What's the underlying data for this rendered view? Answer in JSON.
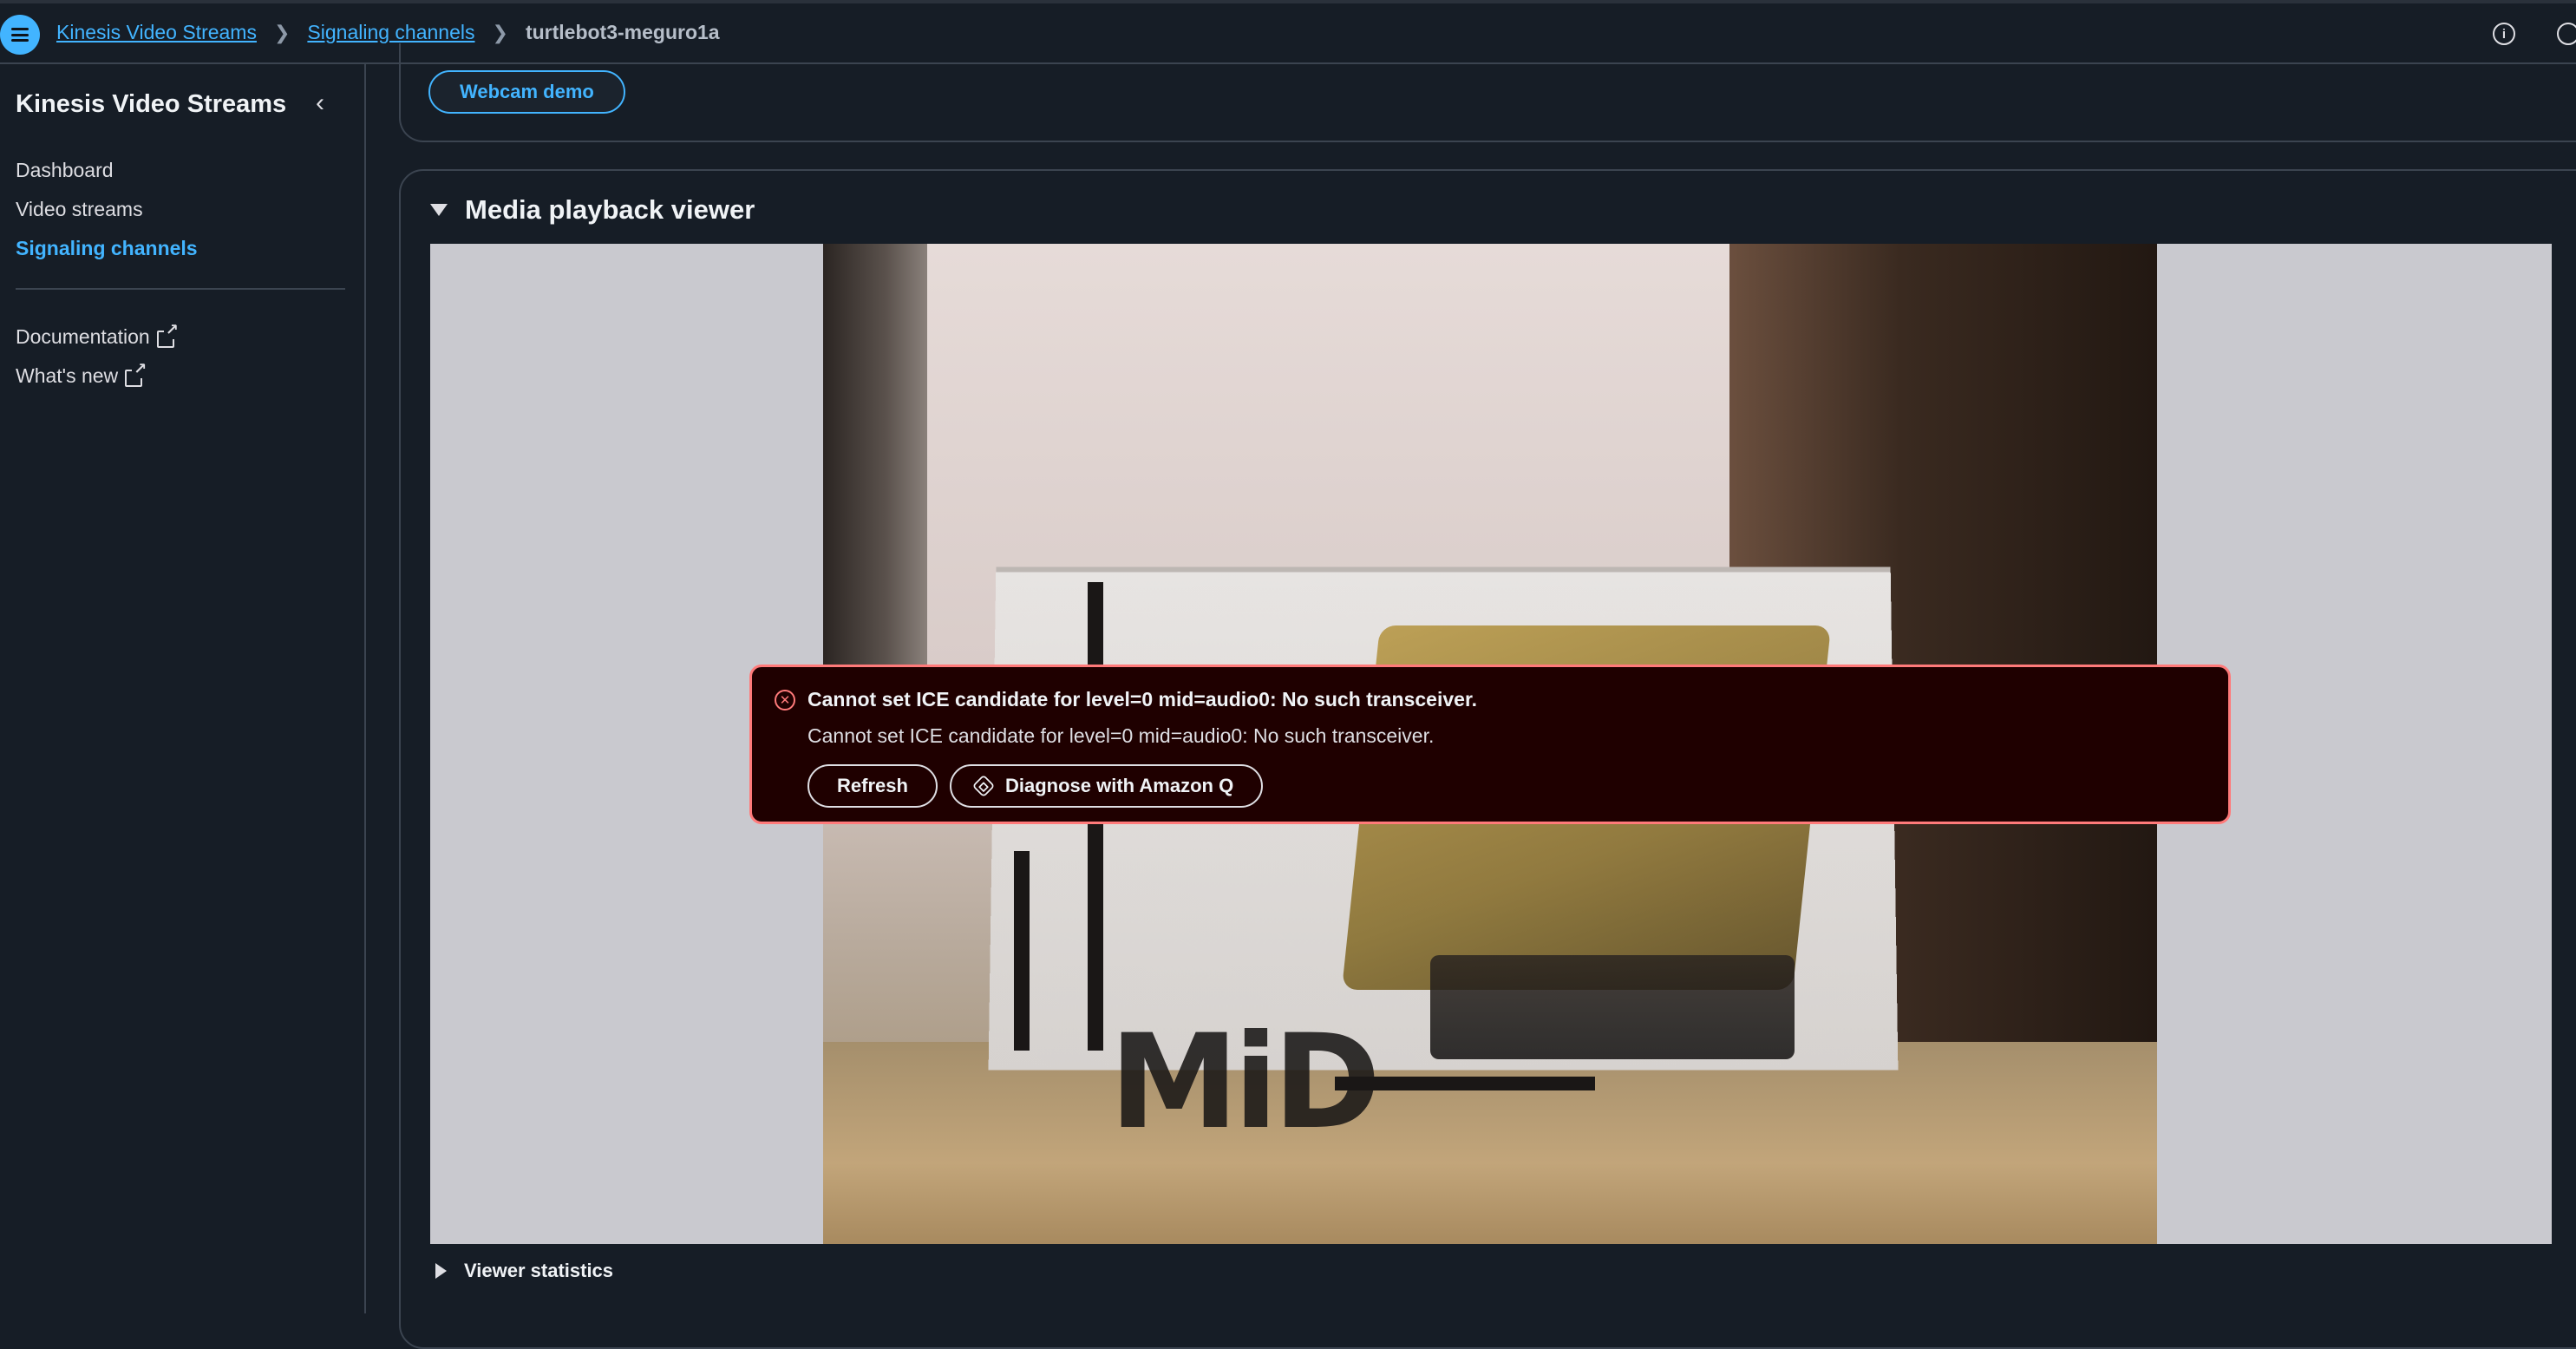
{
  "topbar": {
    "breadcrumbs": [
      {
        "label": "Kinesis Video Streams"
      },
      {
        "label": "Signaling channels"
      },
      {
        "label": "turtlebot3-meguro1a"
      }
    ]
  },
  "sidebar": {
    "title": "Kinesis Video Streams",
    "items": [
      {
        "label": "Dashboard"
      },
      {
        "label": "Video streams"
      },
      {
        "label": "Signaling channels",
        "active": true
      }
    ],
    "links": [
      {
        "label": "Documentation"
      },
      {
        "label": "What's new"
      }
    ]
  },
  "main": {
    "webcam_button": "Webcam demo",
    "viewer_title": "Media playback viewer",
    "viewer_statistics": "Viewer statistics",
    "video_overlay_text": "MiD"
  },
  "alert": {
    "title": "Cannot set ICE candidate for level=0 mid=audio0: No such transceiver.",
    "message": "Cannot set ICE candidate for level=0 mid=audio0: No such transceiver.",
    "refresh_label": "Refresh",
    "diagnose_label": "Diagnose with Amazon Q"
  },
  "colors": {
    "background": "#161d26",
    "accent": "#42b4ff",
    "error_border": "#ff7a7a",
    "error_bg": "#1f0000"
  },
  "icons": [
    "menu-icon",
    "chevron-right-icon",
    "info-icon",
    "chevron-left-icon",
    "external-link-icon",
    "error-icon",
    "amazon-q-icon",
    "caret-down-icon",
    "caret-right-icon"
  ]
}
